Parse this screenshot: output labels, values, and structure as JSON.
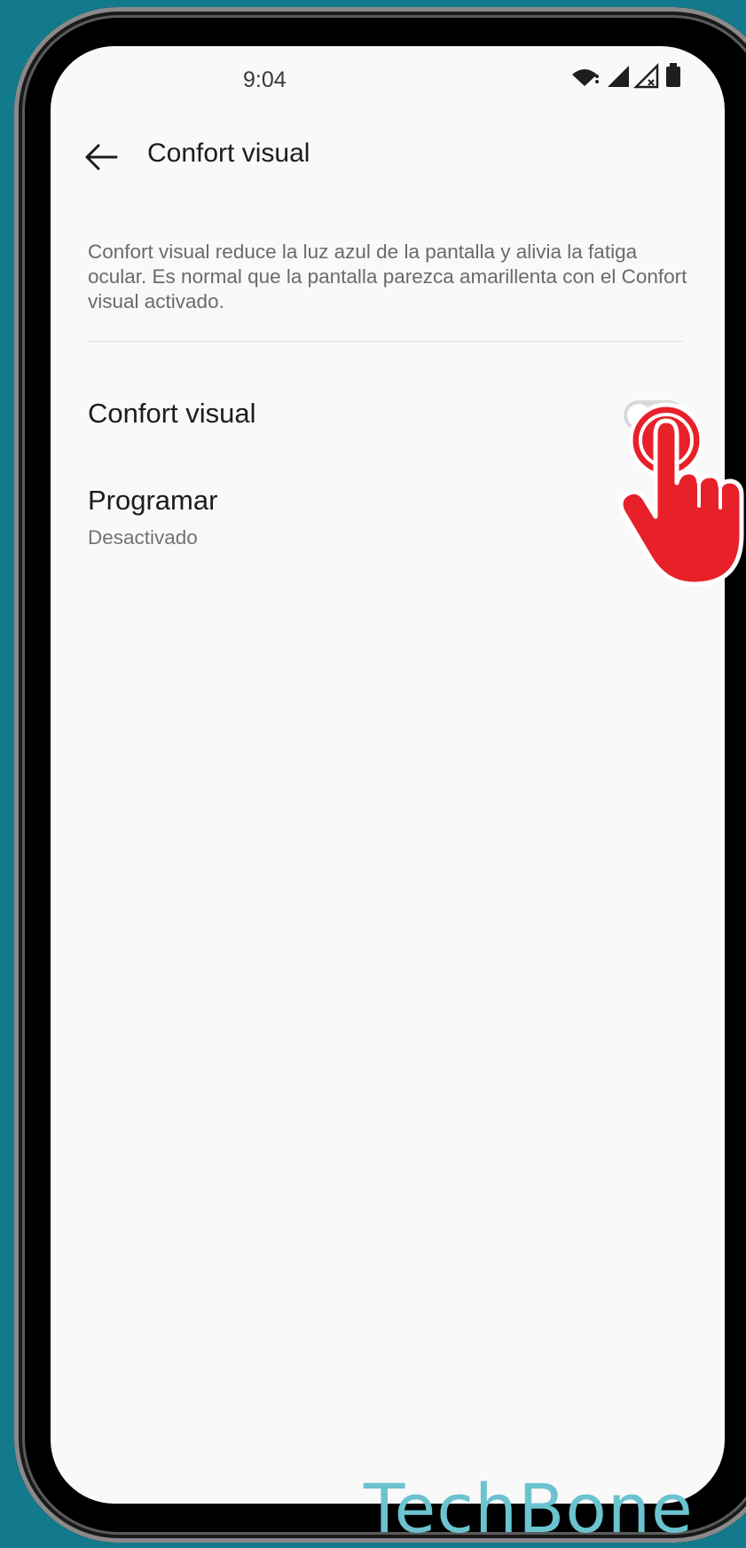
{
  "status_bar": {
    "time": "9:04"
  },
  "header": {
    "title": "Confort visual"
  },
  "description": "Confort visual reduce la luz azul de la pantalla y alivia la fatiga ocular. Es normal que la pantalla parezca amarillenta con el Confort visual activado.",
  "settings": {
    "eye_comfort": {
      "label": "Confort visual",
      "enabled": false
    },
    "schedule": {
      "label": "Programar",
      "value": "Desactivado"
    }
  },
  "watermark": "TechBone",
  "colors": {
    "background": "#127a8c",
    "screen": "#f9f9f9",
    "hand": "#e8202a",
    "watermark": "#6cc3d0"
  },
  "icons": [
    "back-arrow-icon",
    "wifi-icon",
    "signal-icon",
    "signal-no-sim-icon",
    "battery-icon",
    "tap-hand-icon"
  ]
}
